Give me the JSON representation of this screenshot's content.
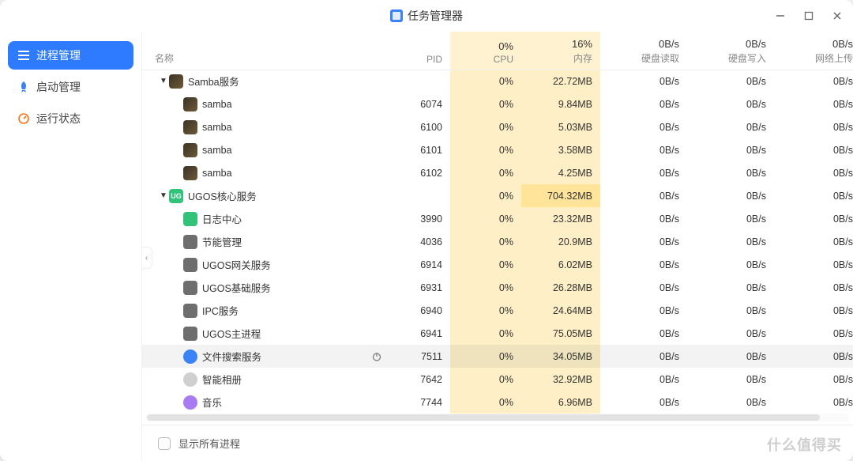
{
  "title": "任务管理器",
  "sidebar": {
    "items": [
      {
        "label": "进程管理"
      },
      {
        "label": "启动管理"
      },
      {
        "label": "运行状态"
      }
    ]
  },
  "table": {
    "headers": {
      "name": "名称",
      "pid": "PID",
      "cpu": "CPU",
      "mem": "内存",
      "read": "硬盘读取",
      "write": "硬盘写入",
      "up": "网络上传"
    },
    "summary": {
      "cpu": "0%",
      "mem": "16%",
      "read": "0B/s",
      "write": "0B/s",
      "up": "0B/s"
    },
    "rows": [
      {
        "name": "Samba服务",
        "pid": "",
        "cpu": "0%",
        "mem": "22.72MB",
        "read": "0B/s",
        "write": "0B/s",
        "up": "0B/s",
        "indent": 0,
        "icon": "samba",
        "expand": true
      },
      {
        "name": "samba",
        "pid": "6074",
        "cpu": "0%",
        "mem": "9.84MB",
        "read": "0B/s",
        "write": "0B/s",
        "up": "0B/s",
        "indent": 1,
        "icon": "samba"
      },
      {
        "name": "samba",
        "pid": "6100",
        "cpu": "0%",
        "mem": "5.03MB",
        "read": "0B/s",
        "write": "0B/s",
        "up": "0B/s",
        "indent": 1,
        "icon": "samba"
      },
      {
        "name": "samba",
        "pid": "6101",
        "cpu": "0%",
        "mem": "3.58MB",
        "read": "0B/s",
        "write": "0B/s",
        "up": "0B/s",
        "indent": 1,
        "icon": "samba"
      },
      {
        "name": "samba",
        "pid": "6102",
        "cpu": "0%",
        "mem": "4.25MB",
        "read": "0B/s",
        "write": "0B/s",
        "up": "0B/s",
        "indent": 1,
        "icon": "samba"
      },
      {
        "name": "UGOS核心服务",
        "pid": "",
        "cpu": "0%",
        "mem": "704.32MB",
        "read": "0B/s",
        "write": "0B/s",
        "up": "0B/s",
        "indent": 0,
        "icon": "ugos",
        "expand": true,
        "memHot": true
      },
      {
        "name": "日志中心",
        "pid": "3990",
        "cpu": "0%",
        "mem": "23.32MB",
        "read": "0B/s",
        "write": "0B/s",
        "up": "0B/s",
        "indent": 1,
        "icon": "log"
      },
      {
        "name": "节能管理",
        "pid": "4036",
        "cpu": "0%",
        "mem": "20.9MB",
        "read": "0B/s",
        "write": "0B/s",
        "up": "0B/s",
        "indent": 1,
        "icon": "power"
      },
      {
        "name": "UGOS网关服务",
        "pid": "6914",
        "cpu": "0%",
        "mem": "6.02MB",
        "read": "0B/s",
        "write": "0B/s",
        "up": "0B/s",
        "indent": 1,
        "icon": "gw"
      },
      {
        "name": "UGOS基础服务",
        "pid": "6931",
        "cpu": "0%",
        "mem": "26.28MB",
        "read": "0B/s",
        "write": "0B/s",
        "up": "0B/s",
        "indent": 1,
        "icon": "base"
      },
      {
        "name": "IPC服务",
        "pid": "6940",
        "cpu": "0%",
        "mem": "24.64MB",
        "read": "0B/s",
        "write": "0B/s",
        "up": "0B/s",
        "indent": 1,
        "icon": "ipc"
      },
      {
        "name": "UGOS主进程",
        "pid": "6941",
        "cpu": "0%",
        "mem": "75.05MB",
        "read": "0B/s",
        "write": "0B/s",
        "up": "0B/s",
        "indent": 1,
        "icon": "main"
      },
      {
        "name": "文件搜索服务",
        "pid": "7511",
        "cpu": "0%",
        "mem": "34.05MB",
        "read": "0B/s",
        "write": "0B/s",
        "up": "0B/s",
        "indent": 1,
        "icon": "search",
        "selected": true,
        "stoppable": true
      },
      {
        "name": "智能相册",
        "pid": "7642",
        "cpu": "0%",
        "mem": "32.92MB",
        "read": "0B/s",
        "write": "0B/s",
        "up": "0B/s",
        "indent": 1,
        "icon": "album"
      },
      {
        "name": "音乐",
        "pid": "7744",
        "cpu": "0%",
        "mem": "6.96MB",
        "read": "0B/s",
        "write": "0B/s",
        "up": "0B/s",
        "indent": 1,
        "icon": "music"
      }
    ]
  },
  "footer": {
    "show_all": "显示所有进程"
  },
  "watermark": "什么值得买"
}
